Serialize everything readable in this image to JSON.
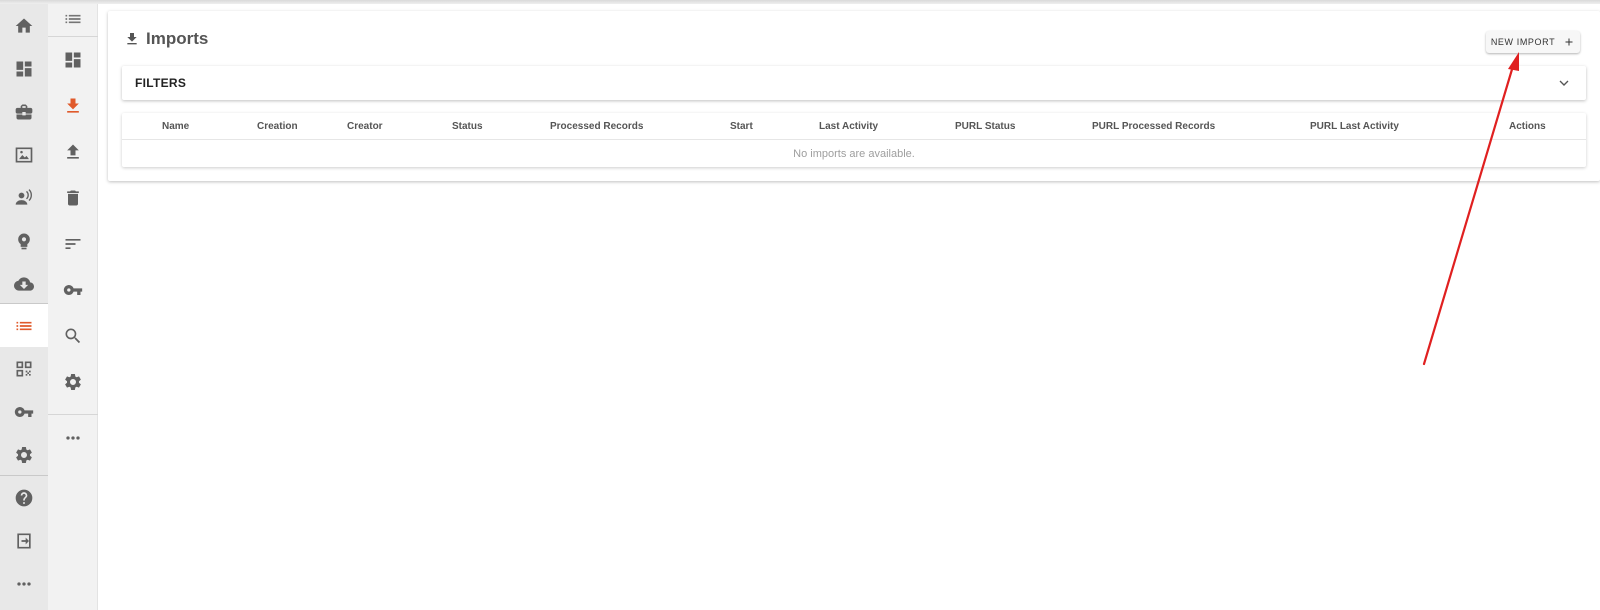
{
  "page": {
    "title": "Imports",
    "new_import_label": "NEW IMPORT"
  },
  "filters": {
    "label": "FILTERS"
  },
  "table": {
    "columns": [
      "Name",
      "Creation",
      "Creator",
      "Status",
      "Processed Records",
      "Start",
      "Last Activity",
      "PURL Status",
      "PURL Processed Records",
      "PURL Last Activity",
      "Actions"
    ],
    "empty_message": "No imports are available."
  },
  "nav_primary": {
    "items": [
      "home-icon",
      "dashboard-icon",
      "briefcase-icon",
      "image-frame-icon",
      "wireless-user-icon",
      "bulb-head-icon",
      "cloud-download-icon",
      "list-icon",
      "qr-code-icon",
      "key-icon",
      "gear-icon",
      "help-icon",
      "exit-icon",
      "more-icon"
    ],
    "active": "list-icon"
  },
  "nav_secondary": {
    "items": [
      "list-icon",
      "dashboard-icon",
      "download-icon",
      "upload-icon",
      "trash-icon",
      "sort-icon",
      "key-icon",
      "search-icon",
      "gear-icon",
      "more-icon"
    ],
    "active": "download-icon"
  },
  "colors": {
    "accent": "#e05a2b",
    "icon": "#616161",
    "annotation_arrow": "#e02020"
  }
}
